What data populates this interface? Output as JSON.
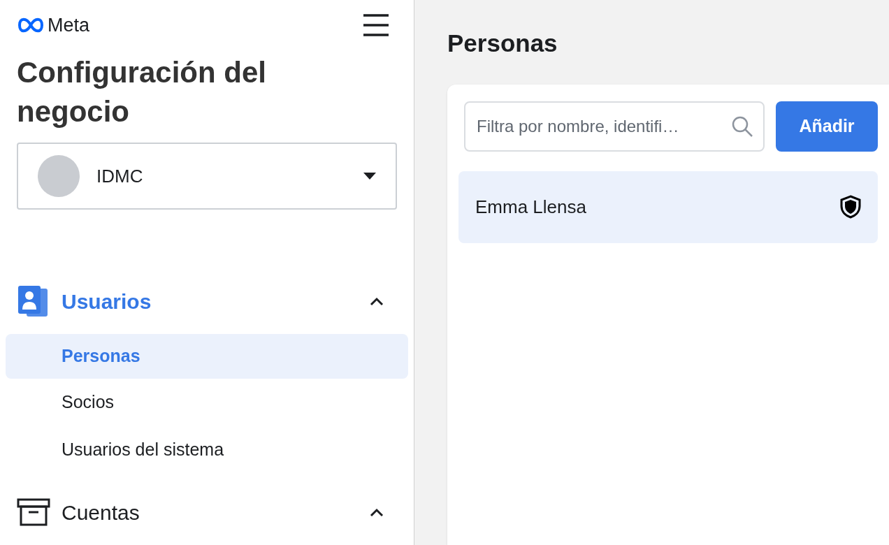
{
  "sidebar": {
    "logo": "Meta",
    "title": "Configuración del negocio",
    "account": {
      "name": "IDMC"
    },
    "sections": [
      {
        "kind": "users",
        "label": "Usuarios",
        "expanded": true,
        "selected": true,
        "items": [
          {
            "label": "Personas",
            "selected": true
          },
          {
            "label": "Socios",
            "selected": false
          },
          {
            "label": "Usuarios del sistema",
            "selected": false
          }
        ]
      },
      {
        "kind": "accounts",
        "label": "Cuentas",
        "expanded": true,
        "selected": false
      }
    ]
  },
  "main": {
    "title": "Personas",
    "search": {
      "placeholder": "Filtra por nombre, identifi…"
    },
    "add_button": "Añadir",
    "people": [
      {
        "name": "Emma Llensa",
        "selected": true
      }
    ]
  }
}
